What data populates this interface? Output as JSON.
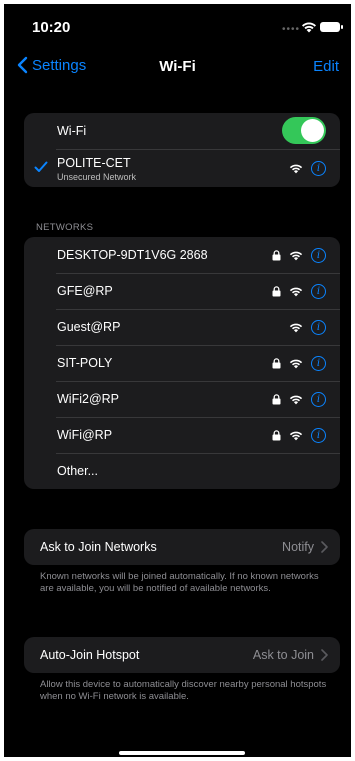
{
  "status_bar": {
    "time": "10:20"
  },
  "nav": {
    "back_label": "Settings",
    "title": "Wi-Fi",
    "edit_label": "Edit"
  },
  "wifi_toggle": {
    "label": "Wi-Fi",
    "on": true
  },
  "connected": {
    "name": "POLITE-CET",
    "subtitle": "Unsecured Network"
  },
  "networks_header": "NETWORKS",
  "networks": [
    {
      "name": "DESKTOP-9DT1V6G 2868",
      "locked": true
    },
    {
      "name": "GFE@RP",
      "locked": true
    },
    {
      "name": "Guest@RP",
      "locked": false
    },
    {
      "name": "SIT-POLY",
      "locked": true
    },
    {
      "name": "WiFi2@RP",
      "locked": true
    },
    {
      "name": "WiFi@RP",
      "locked": true
    }
  ],
  "other_label": "Other...",
  "ask_to_join": {
    "label": "Ask to Join Networks",
    "value": "Notify",
    "footnote": "Known networks will be joined automatically. If no known networks are available, you will be notified of available networks."
  },
  "auto_join": {
    "label": "Auto-Join Hotspot",
    "value": "Ask to Join",
    "footnote": "Allow this device to automatically discover nearby personal hotspots when no Wi-Fi network is available."
  },
  "colors": {
    "accent": "#0a84ff",
    "toggle_on": "#34c759",
    "cell": "#1c1c1e",
    "background": "#000000"
  }
}
